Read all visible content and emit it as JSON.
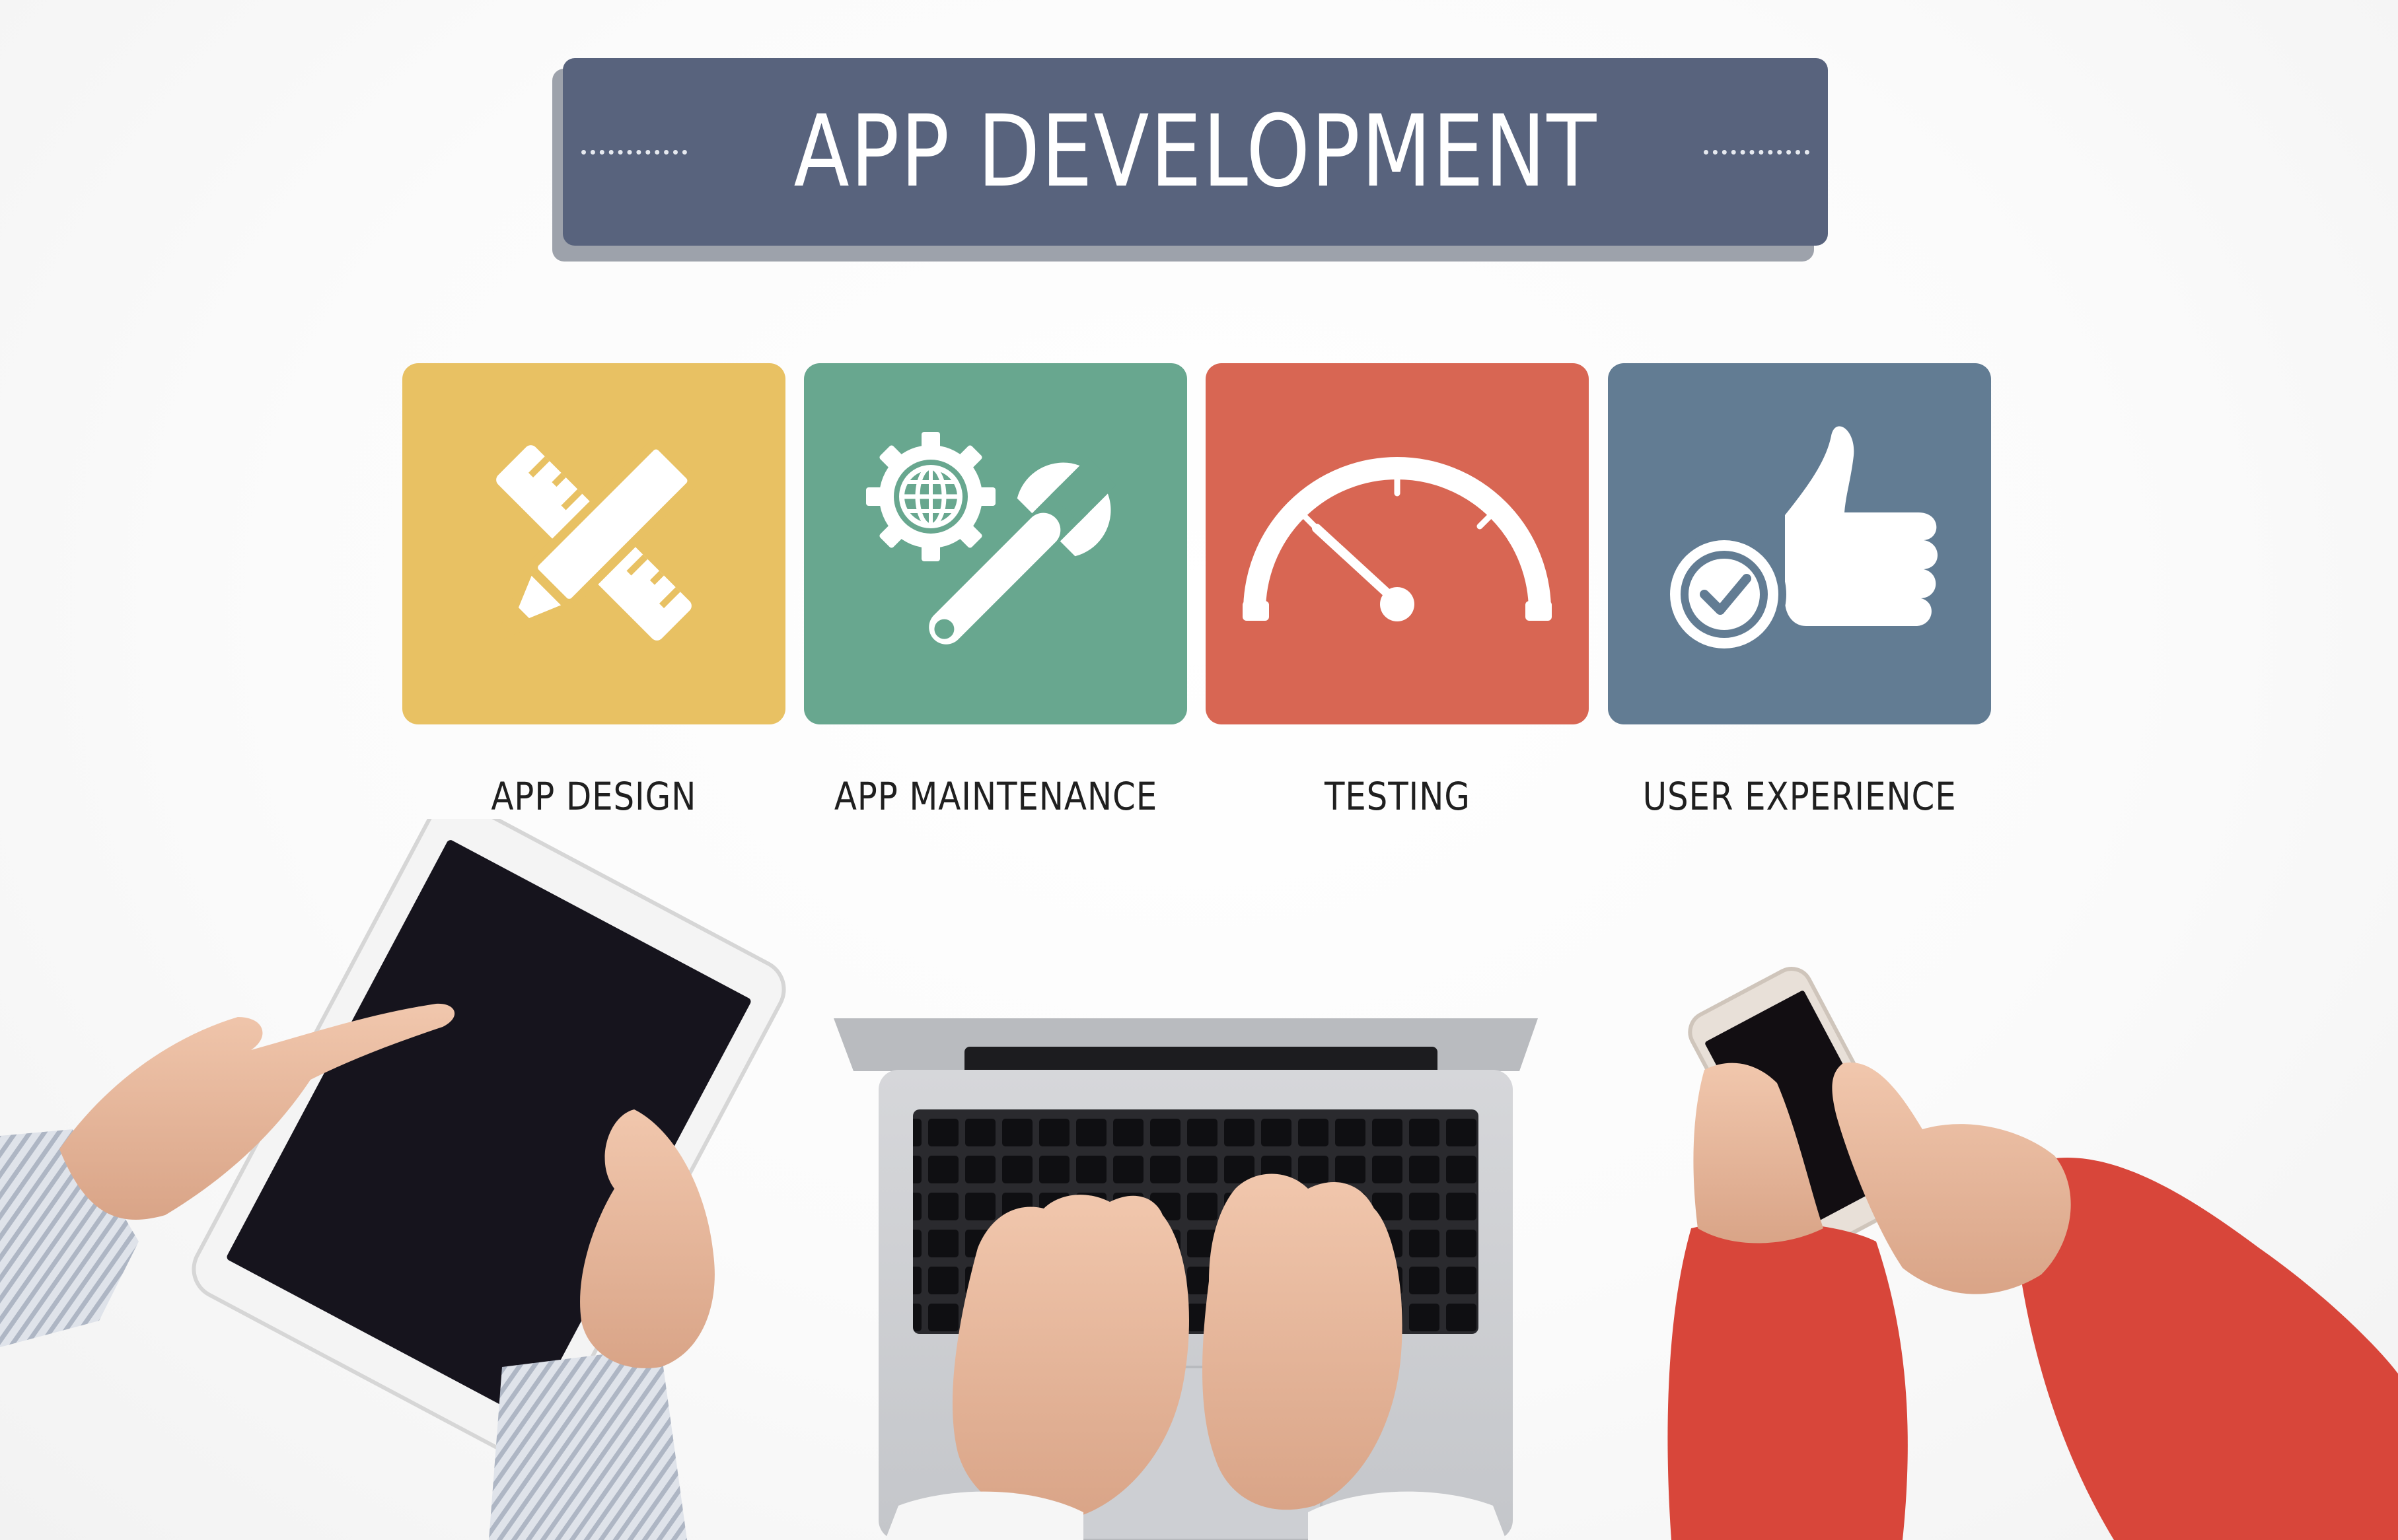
{
  "banner": {
    "title": "APP DEVELOPMENT"
  },
  "tiles": [
    {
      "label": "APP DESIGN",
      "icon": "pencil-ruler-icon",
      "color": "#e8c163"
    },
    {
      "label": "APP MAINTENANCE",
      "icon": "gear-wrench-icon",
      "color": "#68a78f"
    },
    {
      "label": "TESTING",
      "icon": "speedometer-icon",
      "color": "#d86653"
    },
    {
      "label": "USER EXPERIENCE",
      "icon": "thumbs-up-check-icon",
      "color": "#627c93"
    }
  ],
  "colors": {
    "banner": "#58637d",
    "tablet_screen": "#16141d",
    "sleeve_right": "#d8463a"
  }
}
